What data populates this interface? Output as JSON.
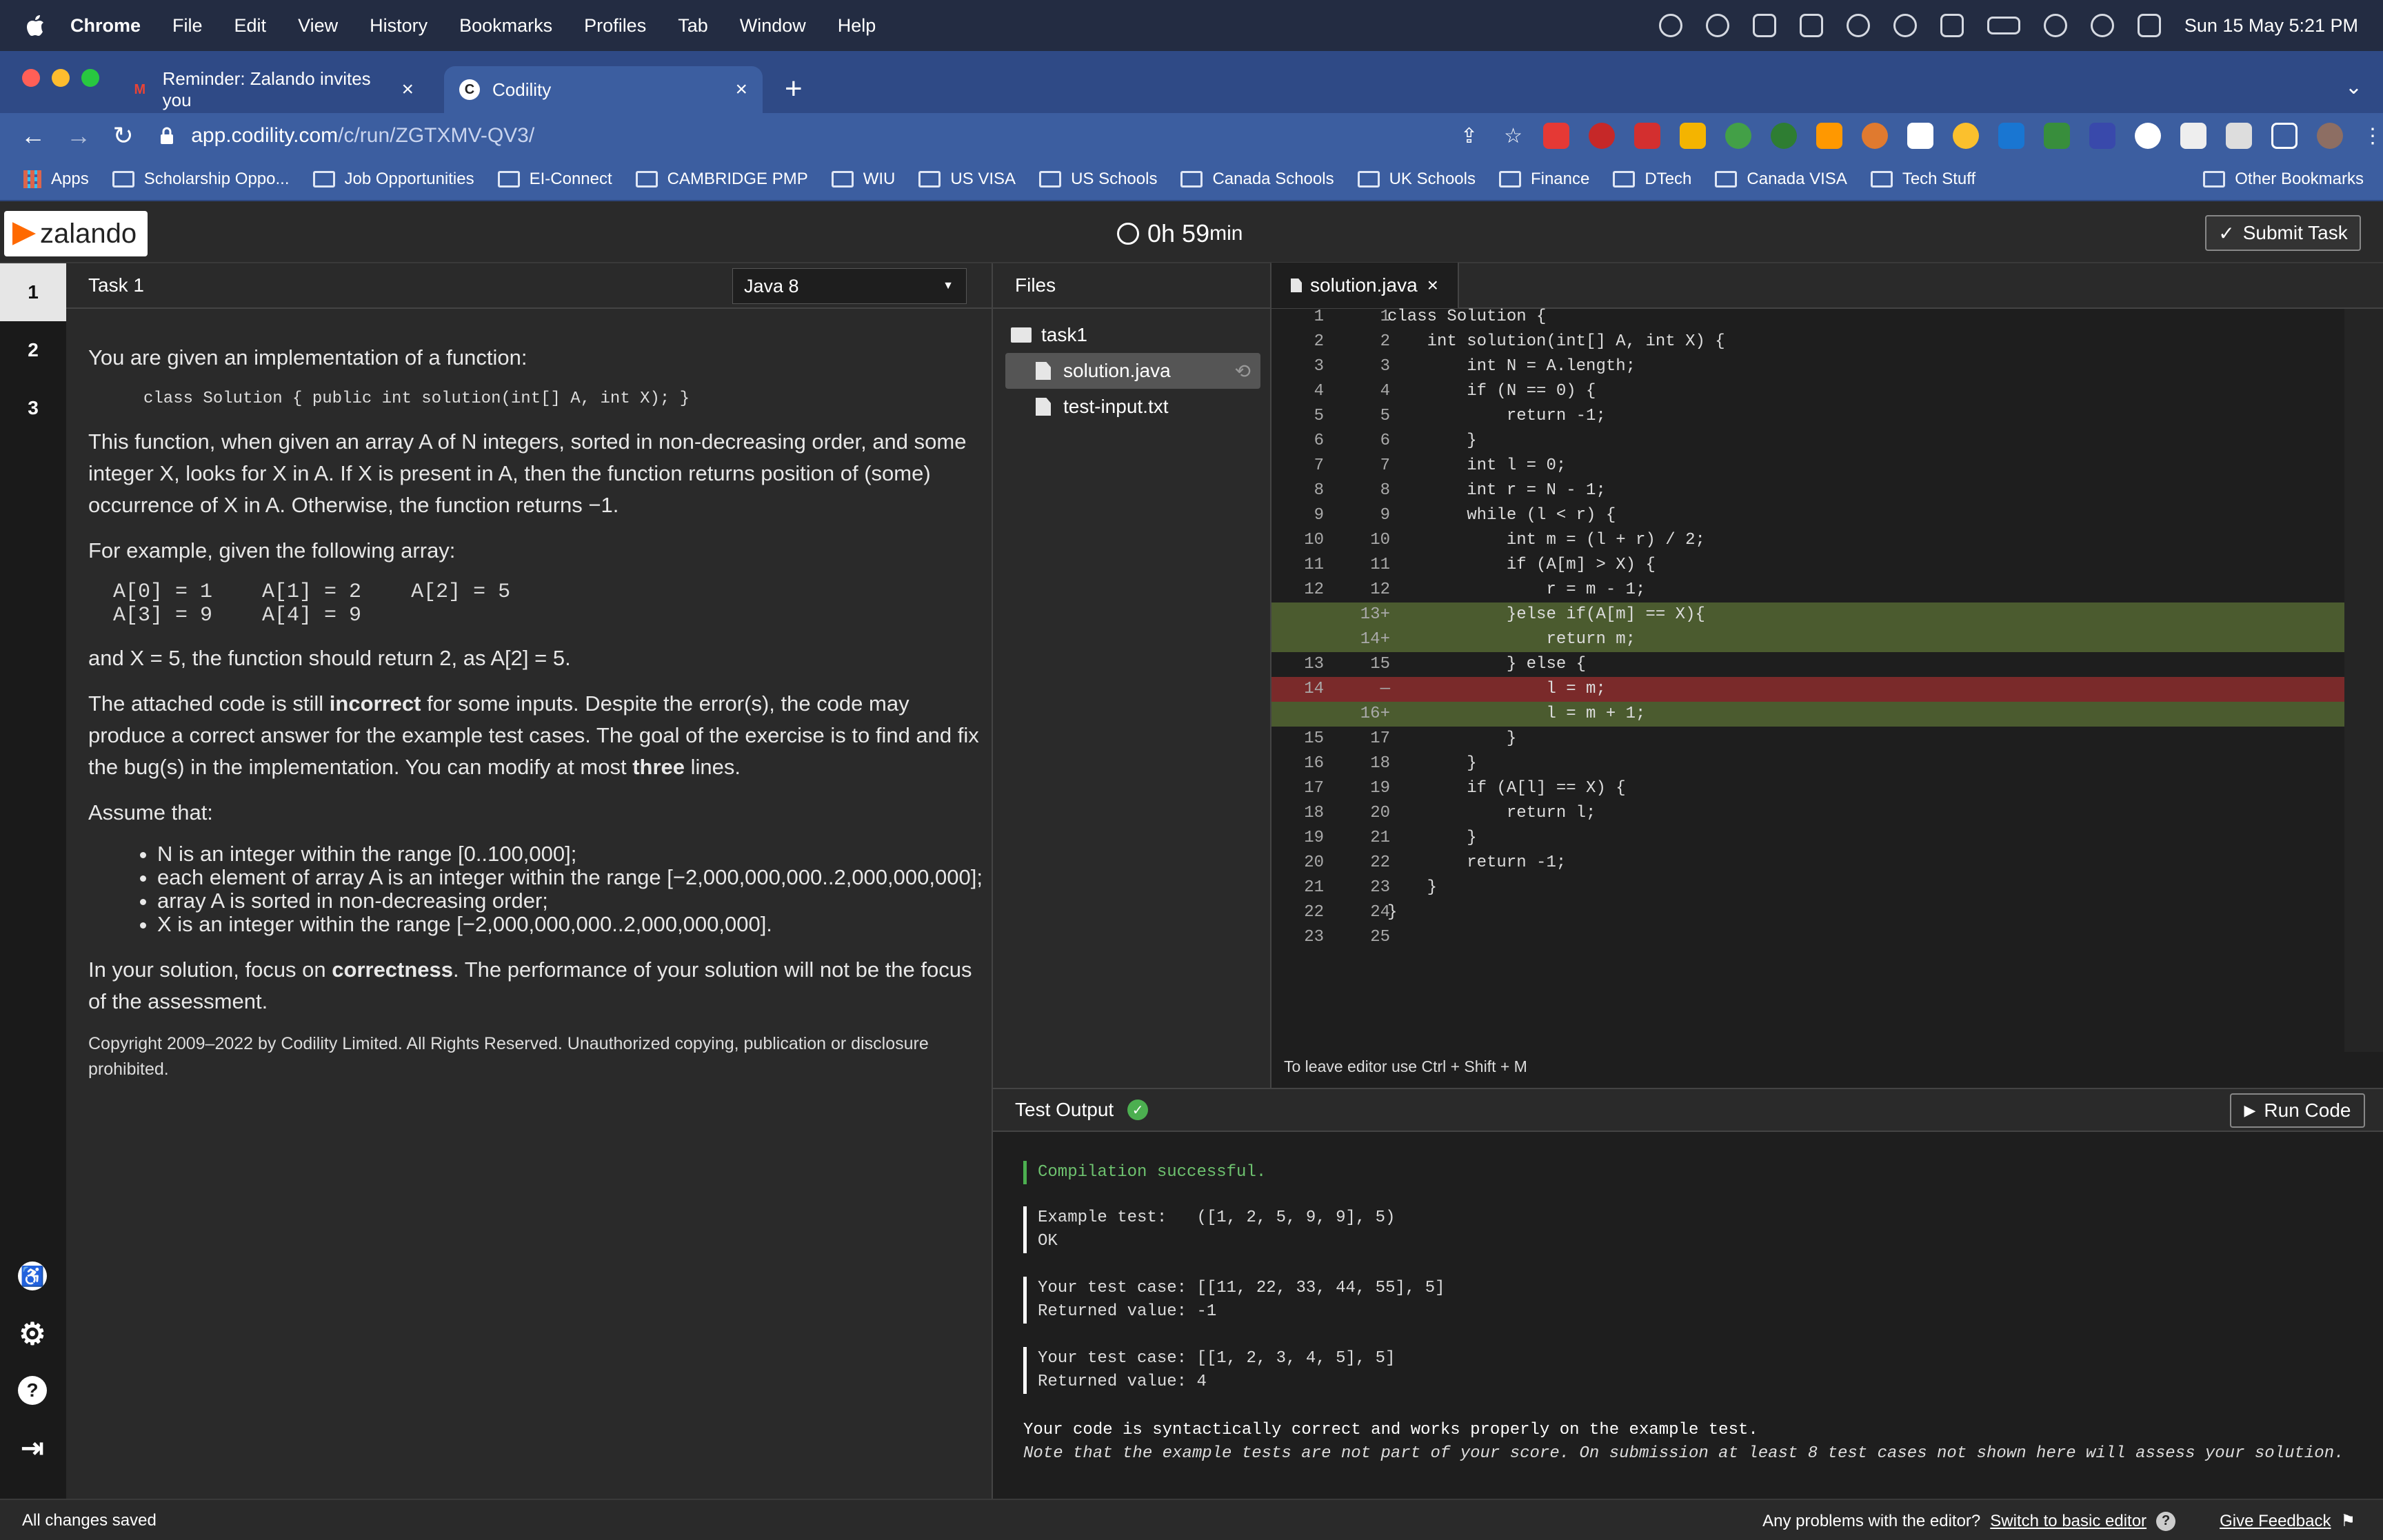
{
  "menubar": {
    "app": "Chrome",
    "items": [
      "File",
      "Edit",
      "View",
      "History",
      "Bookmarks",
      "Profiles",
      "Tab",
      "Window",
      "Help"
    ],
    "datetime": "Sun 15 May  5:21 PM"
  },
  "browser": {
    "tabs": [
      {
        "title": "Reminder: Zalando invites you",
        "favicon": "gmail-icon"
      },
      {
        "title": "Codility",
        "favicon": "codility-icon"
      }
    ],
    "url_host": "app.codility.com",
    "url_path": "/c/run/ZGTXMV-QV3/",
    "bookmarks": [
      "Apps",
      "Scholarship Oppo...",
      "Job Opportunities",
      "EI-Connect",
      "CAMBRIDGE PMP",
      "WIU",
      "US VISA",
      "US Schools",
      "Canada Schools",
      "UK Schools",
      "Finance",
      "DTech",
      "Canada VISA",
      "Tech Stuff"
    ],
    "other_bookmarks": "Other Bookmarks"
  },
  "header": {
    "logo": "zalando",
    "timer_value": "0h 59",
    "timer_unit": "min",
    "submit_label": "Submit Task"
  },
  "tasks": [
    "1",
    "2",
    "3"
  ],
  "task": {
    "title": "Task 1",
    "language": "Java 8",
    "intro": "You are given an implementation of a function:",
    "signature": "class Solution { public int solution(int[] A, int X); }",
    "p1": "This function, when given an array A of N integers, sorted in non-decreasing order, and some integer X, looks for X in A. If X is present in A, then the function returns position of (some) occurrence of X in A. Otherwise, the function returns −1.",
    "p2": "For example, given the following array:",
    "array_line1": "A[0] = 1    A[1] = 2    A[2] = 5",
    "array_line2": "A[3] = 9    A[4] = 9",
    "p3": "and X = 5, the function should return 2, as A[2] = 5.",
    "p4_a": "The attached code is still ",
    "p4_b": "incorrect",
    "p4_c": " for some inputs. Despite the error(s), the code may produce a correct answer for the example test cases. The goal of the exercise is to find and fix the bug(s) in the implementation. You can modify at most ",
    "p4_d": "three",
    "p4_e": " lines.",
    "assume": "Assume that:",
    "bullets": [
      "N is an integer within the range [0..100,000];",
      "each element of array A is an integer within the range [−2,000,000,000..2,000,000,000];",
      "array A is sorted in non-decreasing order;",
      "X is an integer within the range [−2,000,000,000..2,000,000,000]."
    ],
    "p5_a": "In your solution, focus on ",
    "p5_b": "correctness",
    "p5_c": ". The performance of your solution will not be the focus of the assessment.",
    "copyright": "Copyright 2009–2022 by Codility Limited. All Rights Reserved. Unauthorized copying, publication or disclosure prohibited."
  },
  "files": {
    "header": "Files",
    "folder": "task1",
    "items": [
      "solution.java",
      "test-input.txt"
    ]
  },
  "editor": {
    "tab": "solution.java",
    "leave_hint": "To leave editor use Ctrl + Shift + M",
    "lines": [
      {
        "a": "1",
        "b": "1",
        "t": "class Solution {",
        "s": ""
      },
      {
        "a": "2",
        "b": "2",
        "t": "    int solution(int[] A, int X) {",
        "s": ""
      },
      {
        "a": "3",
        "b": "3",
        "t": "        int N = A.length;",
        "s": ""
      },
      {
        "a": "4",
        "b": "4",
        "t": "        if (N == 0) {",
        "s": ""
      },
      {
        "a": "5",
        "b": "5",
        "t": "            return -1;",
        "s": ""
      },
      {
        "a": "6",
        "b": "6",
        "t": "        }",
        "s": ""
      },
      {
        "a": "7",
        "b": "7",
        "t": "        int l = 0;",
        "s": ""
      },
      {
        "a": "8",
        "b": "8",
        "t": "        int r = N - 1;",
        "s": ""
      },
      {
        "a": "9",
        "b": "9",
        "t": "        while (l < r) {",
        "s": ""
      },
      {
        "a": "10",
        "b": "10",
        "t": "            int m = (l + r) / 2;",
        "s": ""
      },
      {
        "a": "11",
        "b": "11",
        "t": "            if (A[m] > X) {",
        "s": ""
      },
      {
        "a": "12",
        "b": "12",
        "t": "                r = m - 1;",
        "s": ""
      },
      {
        "a": "",
        "b": "13+",
        "t": "            }else if(A[m] == X){",
        "s": "add"
      },
      {
        "a": "",
        "b": "14+",
        "t": "                return m;",
        "s": "add"
      },
      {
        "a": "13",
        "b": "15",
        "t": "            } else {",
        "s": ""
      },
      {
        "a": "14",
        "b": "—",
        "t": "                l = m;",
        "s": "del"
      },
      {
        "a": "",
        "b": "16+",
        "t": "                l = m + 1;",
        "s": "add"
      },
      {
        "a": "15",
        "b": "17",
        "t": "            }",
        "s": ""
      },
      {
        "a": "16",
        "b": "18",
        "t": "        }",
        "s": ""
      },
      {
        "a": "17",
        "b": "19",
        "t": "        if (A[l] == X) {",
        "s": ""
      },
      {
        "a": "18",
        "b": "20",
        "t": "            return l;",
        "s": ""
      },
      {
        "a": "19",
        "b": "21",
        "t": "        }",
        "s": ""
      },
      {
        "a": "20",
        "b": "22",
        "t": "        return -1;",
        "s": ""
      },
      {
        "a": "21",
        "b": "23",
        "t": "    }",
        "s": ""
      },
      {
        "a": "22",
        "b": "24",
        "t": "}",
        "s": ""
      },
      {
        "a": "23",
        "b": "25",
        "t": "",
        "s": ""
      }
    ]
  },
  "output": {
    "title": "Test Output",
    "run_label": "Run Code",
    "compilation": "Compilation successful.",
    "example": "Example test:   ([1, 2, 5, 9, 9], 5)\nOK",
    "case1": "Your test case: [[11, 22, 33, 44, 55], 5]\nReturned value: -1",
    "case2": "Your test case: [[1, 2, 3, 4, 5], 5]\nReturned value: 4",
    "summary": "Your code is syntactically correct and works properly on the example test.",
    "note": "Note that the example tests are not part of your score. On submission at least 8 test cases not shown here will assess your solution."
  },
  "status": {
    "saved": "All changes saved",
    "problems": "Any problems with the editor?",
    "switch_link": "Switch to basic editor",
    "feedback": "Give Feedback"
  }
}
